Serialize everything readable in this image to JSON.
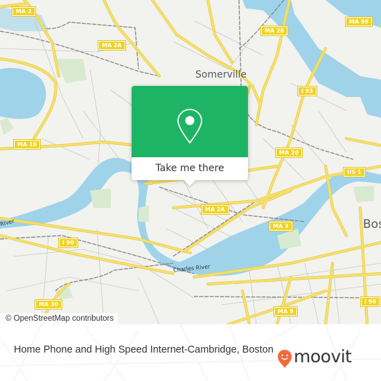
{
  "map": {
    "attribution": "© OpenStreetMap contributors",
    "colors": {
      "land": "#f2f2ef",
      "water": "#9ed3ea",
      "road": "#f6e06b",
      "park": "#d8ead0",
      "rail": "#8a8a8a"
    },
    "places": [
      {
        "name": "Somerville"
      },
      {
        "name": "Bos"
      }
    ],
    "water_labels": [
      {
        "name": "Charles River"
      },
      {
        "name": "River"
      }
    ],
    "route_shields": [
      {
        "label": "MA 2"
      },
      {
        "label": "MA 2A"
      },
      {
        "label": "MA 28"
      },
      {
        "label": "MA 99"
      },
      {
        "label": "I 93"
      },
      {
        "label": "MA 16"
      },
      {
        "label": "MA 28"
      },
      {
        "label": "US 1"
      },
      {
        "label": "MA 2A"
      },
      {
        "label": "MA 3"
      },
      {
        "label": "I 90"
      },
      {
        "label": "MA 30"
      },
      {
        "label": "MA 9"
      },
      {
        "label": "I 90"
      }
    ]
  },
  "popup": {
    "icon": "location-pin-icon",
    "button_label": "Take me there",
    "accent": "#1db565"
  },
  "footer": {
    "title": "Home Phone and High Speed Internet-Cambridge, Boston",
    "brand": "moovit",
    "brand_color": "#f26a3b"
  }
}
